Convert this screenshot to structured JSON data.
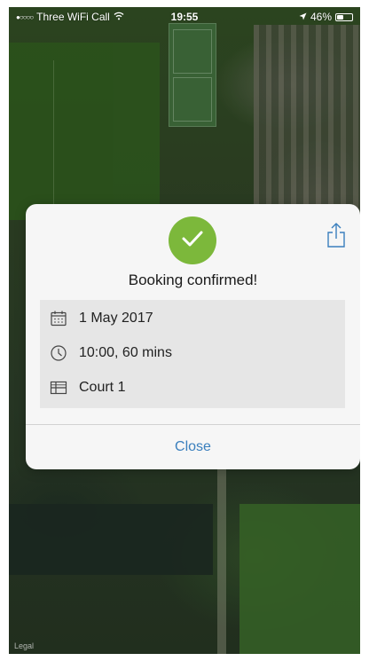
{
  "status_bar": {
    "carrier": "Three WiFi Call",
    "time": "19:55",
    "battery": "46%",
    "battery_level": 0.46
  },
  "map": {
    "legal_label": "Legal"
  },
  "dialog": {
    "title": "Booking confirmed!",
    "details": {
      "date": "1 May 2017",
      "time": "10:00, 60 mins",
      "court": "Court 1"
    },
    "close_label": "Close"
  },
  "colors": {
    "success": "#7cb83b",
    "accent": "#3a7fbd",
    "dialog_bg": "#f6f6f6",
    "details_bg": "#e6e6e6"
  },
  "icons": {
    "success": "check-icon",
    "share": "share-icon",
    "date": "calendar-icon",
    "time": "clock-icon",
    "court": "court-grid-icon"
  }
}
